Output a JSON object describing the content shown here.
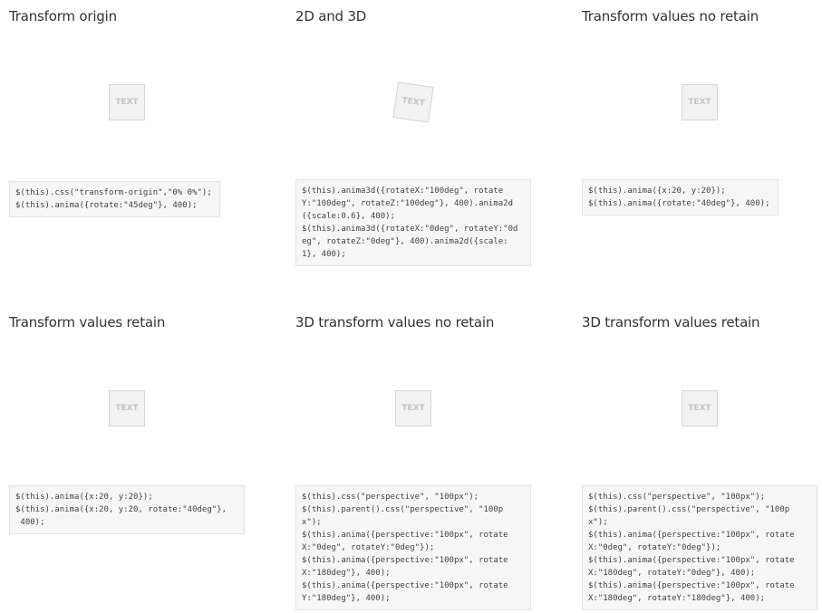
{
  "demos": [
    {
      "title": "Transform origin",
      "box_label": "TEXT",
      "code": "$(this).css(\"transform-origin\",\"0% 0%\");\n$(this).anima({rotate:\"45deg\"}, 400);"
    },
    {
      "title": "2D and 3D",
      "box_label": "TEXT",
      "code": "$(this).anima3d({rotateX:\"100deg\", rotate\nY:\"100deg\", rotateZ:\"100deg\"}, 400).anima2d\n({scale:0.6}, 400);\n$(this).anima3d({rotateX:\"0deg\", rotateY:\"0d\neg\", rotateZ:\"0deg\"}, 400).anima2d({scale:\n1}, 400);"
    },
    {
      "title": "Transform values no retain",
      "box_label": "TEXT",
      "code": "$(this).anima({x:20, y:20});\n$(this).anima({rotate:\"40deg\"}, 400);"
    },
    {
      "title": "Transform values retain",
      "box_label": "TEXT",
      "code": "$(this).anima({x:20, y:20});\n$(this).anima({x:20, y:20, rotate:\"40deg\"},\n 400);"
    },
    {
      "title": "3D transform values no retain",
      "box_label": "TEXT",
      "code": "$(this).css(\"perspective\", \"100px\");\n$(this).parent().css(\"perspective\", \"100p\nx\");\n$(this).anima({perspective:\"100px\", rotate\nX:\"0deg\", rotateY:\"0deg\"});\n$(this).anima({perspective:\"100px\", rotate\nX:\"180deg\"}, 400);\n$(this).anima({perspective:\"100px\", rotate\nY:\"180deg\"}, 400);"
    },
    {
      "title": "3D transform values retain",
      "box_label": "TEXT",
      "code": "$(this).css(\"perspective\", \"100px\");\n$(this).parent().css(\"perspective\", \"100p\nx\");\n$(this).anima({perspective:\"100px\", rotate\nX:\"0deg\", rotateY:\"0deg\"});\n$(this).anima({perspective:\"100px\", rotate\nX:\"180deg\", rotateY:\"0deg\"}, 400);\n$(this).anima({perspective:\"100px\", rotate\nX:\"180deg\", rotateY:\"180deg\"}, 400);"
    }
  ]
}
